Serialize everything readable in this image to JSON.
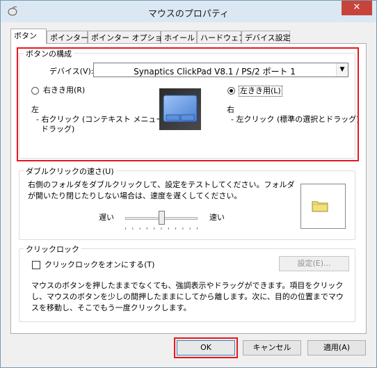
{
  "window": {
    "title": "マウスのプロパティ",
    "close_label": "✕"
  },
  "tabs": [
    {
      "label": "ボタン"
    },
    {
      "label": "ポインター"
    },
    {
      "label": "ポインター オプション"
    },
    {
      "label": "ホイール"
    },
    {
      "label": "ハードウェア"
    },
    {
      "label": "デバイス設定"
    }
  ],
  "button_config": {
    "legend": "ボタンの構成",
    "device_label": "デバイス(V):",
    "device_value": "Synaptics ClickPad V8.1 / PS/2 ポート 1",
    "right_handed_label": "右きき用(R)",
    "left_handed_label": "左きき用(L)",
    "selected": "left",
    "left_desc_title": "左",
    "left_desc_line1": "- 右クリック (コンテキスト メニューと補助",
    "left_desc_line2": "ドラッグ)",
    "right_desc_title": "右",
    "right_desc_line1": "- 左クリック (標準の選択とドラッグ)"
  },
  "double_click": {
    "legend": "ダブルクリックの速さ(U)",
    "description": "右側のフォルダをダブルクリックして、設定をテストしてください。フォルダが開いたり閉じたりしない場合は、速度を遅くしてください。",
    "slow_label": "遅い",
    "fast_label": "速い",
    "speed_position": 0.5
  },
  "click_lock": {
    "legend": "クリックロック",
    "checkbox_label": "クリックロックをオンにする(T)",
    "checked": false,
    "settings_button": "設定(E)...",
    "description": "マウスのボタンを押したままでなくても、強調表示やドラッグができます。項目をクリックし、マウスのボタンを少しの間押したままにしてから離します。次に、目的の位置までマウスを移動し、そこでもう一度クリックします。"
  },
  "footer": {
    "ok_label": "OK",
    "cancel_label": "キャンセル",
    "apply_label": "適用(A)"
  },
  "colors": {
    "highlight_frame": "#e8161f",
    "titlebar": "#dbe8f3",
    "close": "#c7443b"
  }
}
